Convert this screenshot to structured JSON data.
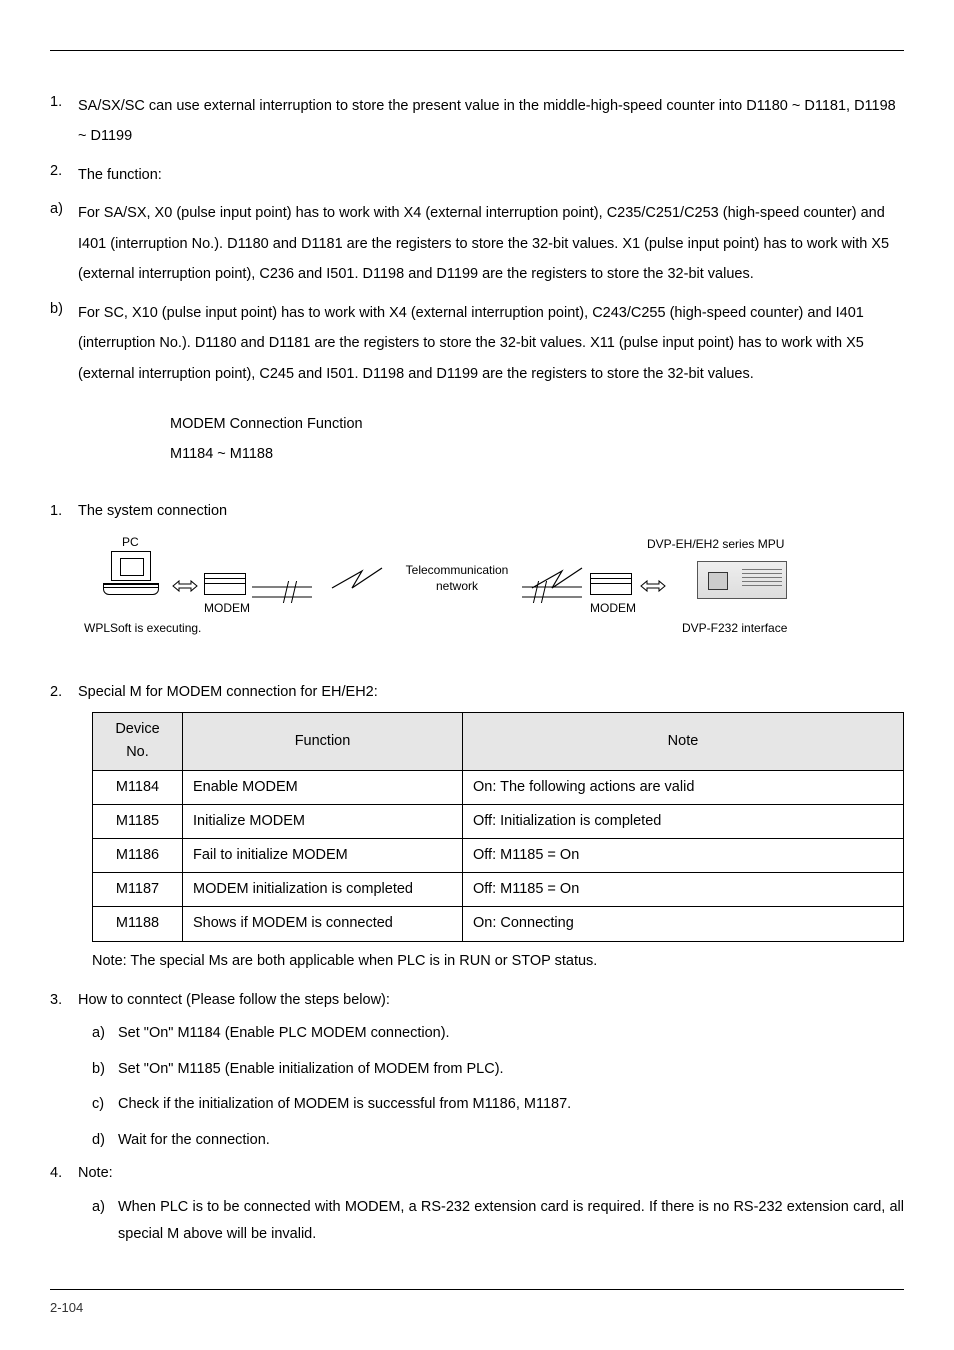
{
  "top_list": [
    {
      "num": "1.",
      "text": "SA/SX/SC can use external interruption to store the present value in the middle-high-speed counter into D1180 ~ D1181, D1198 ~ D1199"
    },
    {
      "num": "2.",
      "text": "The function:"
    },
    {
      "num": "a)",
      "text": "For SA/SX, X0 (pulse input point) has to work with X4 (external interruption point), C235/C251/C253 (high-speed counter) and I401 (interruption No.). D1180 and D1181 are the registers to store the 32-bit values. X1 (pulse input point) has to work with X5 (external interruption point), C236 and I501. D1198 and D1199 are the registers to store the 32-bit values."
    },
    {
      "num": "b)",
      "text": "For SC, X10 (pulse input point) has to work with X4 (external interruption point), C243/C255 (high-speed counter) and I401 (interruption No.). D1180 and D1181 are the registers to store the 32-bit values. X11 (pulse input point) has to work with X5 (external interruption point), C245 and I501. D1198 and D1199 are the registers to store the 32-bit values."
    }
  ],
  "section_title": {
    "line1": "MODEM Connection Function",
    "line2": "M1184 ~ M1188"
  },
  "step1": {
    "num": "1.",
    "text": "The system connection"
  },
  "diagram": {
    "pc": "PC",
    "wpl": "WPLSoft is executing.",
    "modem": "MODEM",
    "tele1": "Telecommunication",
    "tele2": "network",
    "mpu": "DVP-EH/EH2 series MPU",
    "iface": "DVP-F232 interface"
  },
  "step2": {
    "num": "2.",
    "text": "Special M for MODEM connection for EH/EH2:"
  },
  "table": {
    "headers": {
      "c1": "Device No.",
      "c2": "Function",
      "c3": "Note"
    },
    "rows": [
      {
        "c1": "M1184",
        "c2": "Enable MODEM",
        "c3": "On: The following actions are valid"
      },
      {
        "c1": "M1185",
        "c2": "Initialize MODEM",
        "c3": "Off: Initialization is completed"
      },
      {
        "c1": "M1186",
        "c2": "Fail to initialize MODEM",
        "c3": "Off: M1185 = On"
      },
      {
        "c1": "M1187",
        "c2": "MODEM initialization is completed",
        "c3": "Off: M1185 = On"
      },
      {
        "c1": "M1188",
        "c2": "Shows if MODEM is connected",
        "c3": "On: Connecting"
      }
    ]
  },
  "table_note": "Note: The special Ms are both applicable when PLC is in RUN or STOP status.",
  "step3": {
    "num": "3.",
    "text": "How to conntect (Please follow the steps below):"
  },
  "step3_sub": [
    {
      "num": "a)",
      "text": "Set \"On\" M1184 (Enable PLC MODEM connection)."
    },
    {
      "num": "b)",
      "text": "Set \"On\" M1185 (Enable initialization of MODEM from PLC)."
    },
    {
      "num": "c)",
      "text": "Check if the initialization of MODEM is successful from M1186, M1187."
    },
    {
      "num": "d)",
      "text": "Wait for the connection."
    }
  ],
  "step4": {
    "num": "4.",
    "text": "Note:"
  },
  "step4_sub": [
    {
      "num": "a)",
      "text": "When PLC is to be connected with MODEM, a RS-232 extension card is required. If there is no RS-232 extension card, all special M above will be invalid."
    }
  ],
  "page": "2-104"
}
